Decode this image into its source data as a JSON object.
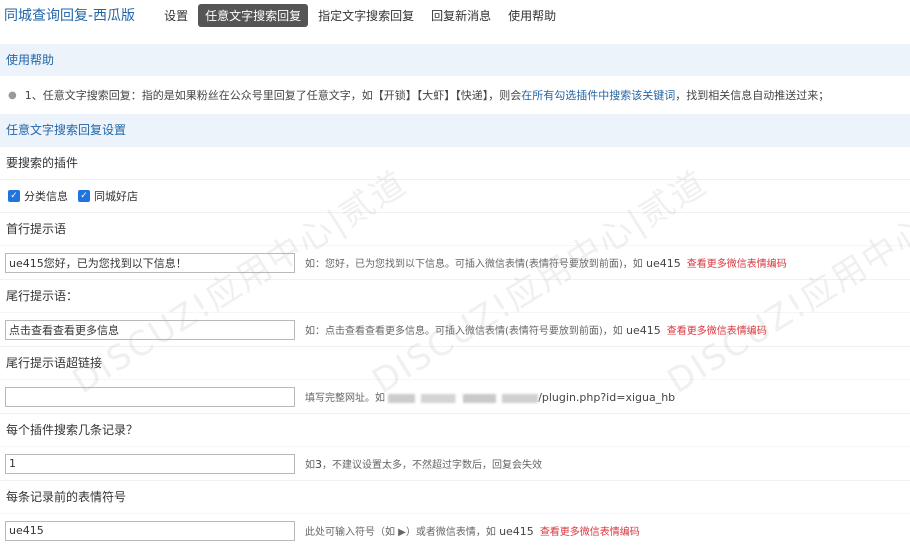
{
  "app_title": "同城查询回复-西瓜版",
  "nav": [
    "设置",
    "任意文字搜索回复",
    "指定文字搜索回复",
    "回复新消息",
    "使用帮助"
  ],
  "help": {
    "title": "使用帮助",
    "line_pre": "1、任意文字搜索回复：指的是如果粉丝在公众号里回复了任意文字，如【开锁】【大虾】【快递】，则会",
    "line_link": "在所有勾选插件中搜索该关键词",
    "line_post": "，找到相关信息自动推送过来；"
  },
  "settings": {
    "title": "任意文字搜索回复设置",
    "plugins_label": "要搜索的插件",
    "plugins": [
      "分类信息",
      "同城好店"
    ],
    "first_label": "首行提示语",
    "first_value": "ue415您好，已为您找到以下信息！",
    "first_tip": "如：您好，已为您找到以下信息。可插入微信表情(表情符号要放到前面)，如",
    "first_tip_code": "ue415",
    "tail_label": "尾行提示语：",
    "tail_value": "点击查看查看更多信息",
    "tail_tip": "如：点击查看查看更多信息。可插入微信表情(表情符号要放到前面)，如",
    "tail_tip_code": "ue415",
    "link_label": "尾行提示语超链接",
    "link_value": "",
    "link_tip": "填写完整网址。如",
    "link_tip_code": "/plugin.php?id=xigua_hb",
    "count_label": "每个插件搜索几条记录？",
    "count_value": "1",
    "count_tip_pre": "如",
    "count_tip_num": "3",
    "count_tip_post": "，不建议设置太多，不然超过字数后，回复会失效",
    "emoji_label": "每条记录前的表情符号",
    "emoji_value": "ue415",
    "emoji_tip": "此处可输入符号（如 ▶）或者微信表情，如",
    "emoji_tip_code": "ue415",
    "more_emoji_link": "查看更多微信表情编码"
  },
  "watermark": "DISCUZ!应用中心|贰道"
}
